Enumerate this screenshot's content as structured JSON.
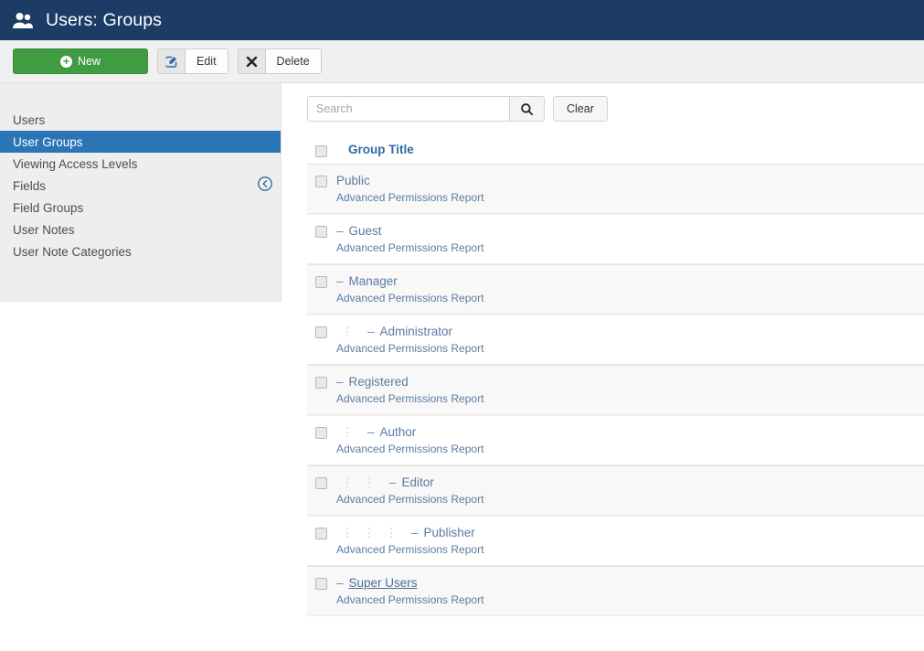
{
  "header": {
    "icon": "users-icon",
    "title": "Users: Groups",
    "bg": "#1c3c65"
  },
  "toolbar": {
    "new_label": "New",
    "new_icon": "plus-circle-icon",
    "new_color": "#3f9c42",
    "edit_label": "Edit",
    "edit_icon": "pencil-square-icon",
    "delete_label": "Delete",
    "delete_icon": "x-mark-icon"
  },
  "sidebar": {
    "collapse_icon": "circle-arrow-left-icon",
    "active_color": "#2b74b6",
    "items": [
      {
        "label": "Users",
        "active": false
      },
      {
        "label": "User Groups",
        "active": true
      },
      {
        "label": "Viewing Access Levels",
        "active": false
      },
      {
        "label": "Fields",
        "active": false
      },
      {
        "label": "Field Groups",
        "active": false
      },
      {
        "label": "User Notes",
        "active": false
      },
      {
        "label": "User Note Categories",
        "active": false
      }
    ]
  },
  "search": {
    "value": "",
    "placeholder": "Search",
    "search_icon": "magnifier-icon",
    "clear_label": "Clear"
  },
  "list": {
    "column_header": "Group Title",
    "sub_link_label": "Advanced Permissions Report",
    "rows": [
      {
        "title": "Public",
        "depth": 0,
        "pipes": 0,
        "dash": false,
        "shaded": true,
        "hovered": false
      },
      {
        "title": "Guest",
        "depth": 1,
        "pipes": 0,
        "dash": true,
        "shaded": false,
        "hovered": false
      },
      {
        "title": "Manager",
        "depth": 1,
        "pipes": 0,
        "dash": true,
        "shaded": true,
        "hovered": false
      },
      {
        "title": "Administrator",
        "depth": 2,
        "pipes": 1,
        "dash": true,
        "shaded": false,
        "hovered": false
      },
      {
        "title": "Registered",
        "depth": 1,
        "pipes": 0,
        "dash": true,
        "shaded": true,
        "hovered": false
      },
      {
        "title": "Author",
        "depth": 2,
        "pipes": 1,
        "dash": true,
        "shaded": false,
        "hovered": false
      },
      {
        "title": "Editor",
        "depth": 3,
        "pipes": 2,
        "dash": true,
        "shaded": true,
        "hovered": false
      },
      {
        "title": "Publisher",
        "depth": 4,
        "pipes": 3,
        "dash": true,
        "shaded": false,
        "hovered": false
      },
      {
        "title": "Super Users",
        "depth": 1,
        "pipes": 0,
        "dash": true,
        "shaded": true,
        "hovered": true
      }
    ]
  }
}
